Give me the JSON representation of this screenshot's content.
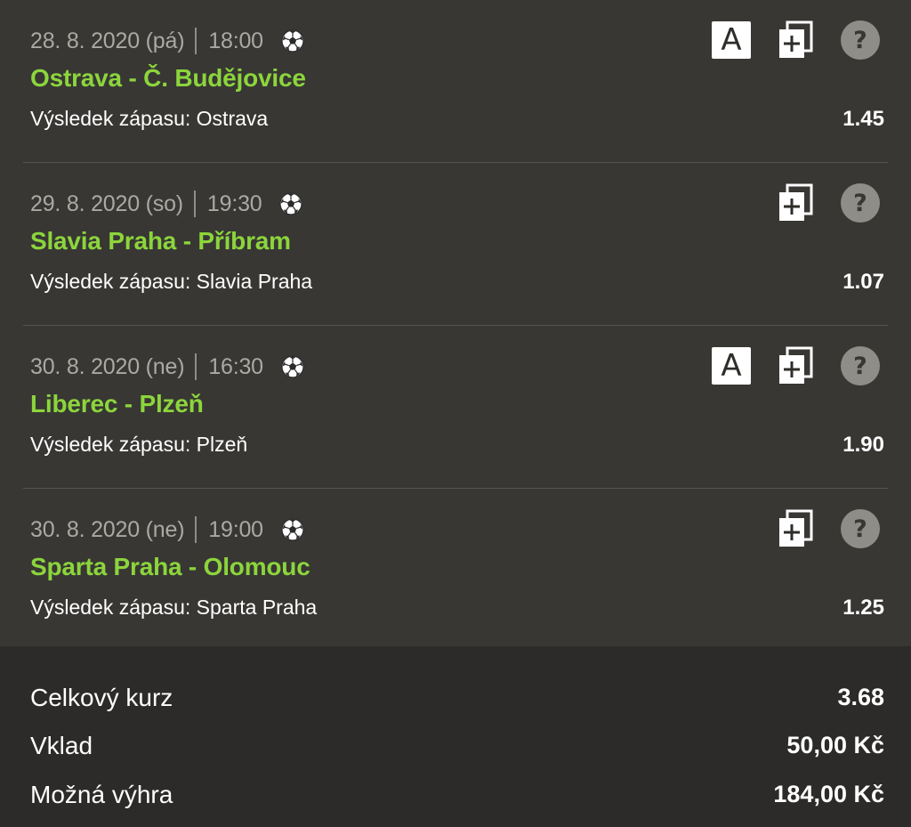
{
  "bets": [
    {
      "date": "28. 8. 2020 (pá)",
      "time": "18:00",
      "sport_icon": "soccer-ball-icon",
      "match": "Ostrava - Č. Budějovice",
      "market": "Výsledek zápasu: Ostrava",
      "odds": "1.45",
      "has_live_badge": true,
      "live_badge": "A"
    },
    {
      "date": "29. 8. 2020 (so)",
      "time": "19:30",
      "sport_icon": "soccer-ball-icon",
      "match": "Slavia Praha - Příbram",
      "market": "Výsledek zápasu: Slavia Praha",
      "odds": "1.07",
      "has_live_badge": false,
      "live_badge": ""
    },
    {
      "date": "30. 8. 2020 (ne)",
      "time": "16:30",
      "sport_icon": "soccer-ball-icon",
      "match": "Liberec - Plzeň",
      "market": "Výsledek zápasu: Plzeň",
      "odds": "1.90",
      "has_live_badge": true,
      "live_badge": "A"
    },
    {
      "date": "30. 8. 2020 (ne)",
      "time": "19:00",
      "sport_icon": "soccer-ball-icon",
      "match": "Sparta Praha - Olomouc",
      "market": "Výsledek zápasu: Sparta Praha",
      "odds": "1.25",
      "has_live_badge": false,
      "live_badge": ""
    }
  ],
  "summary": {
    "total_odds_label": "Celkový kurz",
    "total_odds_value": "3.68",
    "stake_label": "Vklad",
    "stake_value": "50,00 Kč",
    "win_label": "Možná výhra",
    "win_value": "184,00 Kč"
  },
  "colors": {
    "background": "#383734",
    "summary_background": "#2c2b29",
    "match_name": "#8cd53c",
    "meta_text": "#aaa9a4",
    "text": "#ffffff",
    "icon_grey": "#8e8d88"
  },
  "icons": {
    "live_badge": "live-stream-icon",
    "copy": "add-to-ticket-icon",
    "help": "help-icon"
  }
}
